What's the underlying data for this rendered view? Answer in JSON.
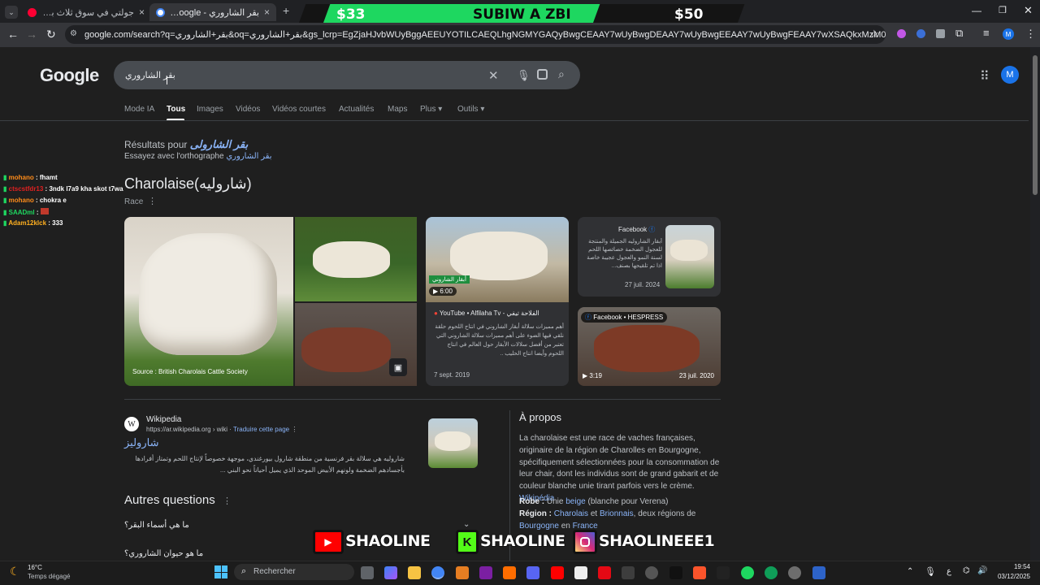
{
  "browser": {
    "tabs": [
      {
        "title": "جولتي في سوق ثلاث براكة الراضي",
        "close": "×"
      },
      {
        "title": "بقر الشاروري - Rechercher Google",
        "close": "×"
      }
    ],
    "new_tab": "+",
    "url": "google.com/search?q=بقر+الشاروري&oq=بقر+الشاروري&gs_lcrp=EgZjaHJvbWUyBggAEEUYOTILCAEQLhgNGMYGAQyBwgCEAAY7wUyBwgDEAAY7wUyBwgEEAAY7wUyBwgFEAAY7wXSAQkxMzM0MWowajeoAgCwAg...",
    "profile_initial": "M"
  },
  "stream_banner": {
    "left": "$33",
    "center": "SUBIW A ZBI",
    "right": "$50"
  },
  "search": {
    "logo": "Google",
    "query": "بقر الشاروري",
    "tabs": [
      "Mode IA",
      "Tous",
      "Images",
      "Vidéos",
      "Vidéos courtes",
      "Actualités",
      "Maps",
      "Plus",
      "Outils"
    ],
    "active_tab": "Tous"
  },
  "spelling": {
    "results_for_label": "Résultats pour",
    "corrected": "بقر الشارولى",
    "try_label": "Essayez avec l'orthographe",
    "original": "بقر الشاروري"
  },
  "knowledge": {
    "title": "Charolaise(شاروليه)",
    "subtitle": "Race",
    "image_credit": "Source : British Charolais Cattle Society"
  },
  "video_card": {
    "badge": "أبقار الشاروني",
    "duration": "6:00",
    "source": "YouTube • Alfilaha Tv - الفلاحة تيفي",
    "text": "أهم مميزات سلالة أبقار الشاروني في انتاج اللحوم حلقة نلقي فيها الضوء على أهم مميزات سلالة الشاروني التي تعتبر من أفضل سلالات الأبقار حول العالم في انتاج اللحوم وأيضا انتاج الحليب ..",
    "date": "7 sept. 2019"
  },
  "facebook_card": {
    "source": "Facebook",
    "text": "أبقار الشاروليه الجميلة والمنتجة للعجول الضخمة خصائصها اللحم لسنة النمو والعجول عجيبة خاصة اذا تم تلقيحها بصنف...",
    "date": "27 juil. 2024"
  },
  "hespress_card": {
    "source": "Facebook • HESPRESS",
    "duration": "3:19",
    "date": "23 juil. 2020"
  },
  "wiki_result": {
    "site": "Wikipedia",
    "url": "https://ar.wikipedia.org › wiki",
    "translate": "Traduire cette page",
    "title": "شاروليز",
    "snippet": "شاروليه هي سلالة بقر فرنسية من منطقة شارول بيورغندي، موجهة خصوصاً لإنتاج اللحم وتمتاز أفرادها بأجسادهم الضخمة ولونهم الأبيض الموحد الذي يميل أحياناً نحو البني ..."
  },
  "paa": {
    "title": "Autres questions",
    "questions": [
      "ما هي أسماء البقر؟",
      "ما هو حيوان الشاروري؟"
    ]
  },
  "about": {
    "title": "À propos",
    "description": "La charolaise est une race de vaches françaises, originaire de la région de Charolles en Bourgogne, spécifiquement sélectionnées pour la consommation de leur chair, dont les individus sont de grand gabarit et de couleur blanche unie tirant parfois vers le crème.",
    "source_link": "Wikipédia",
    "robe_label": "Robe :",
    "robe_text1": "Unie",
    "robe_link": "beige",
    "robe_text2": "(blanche pour Verena)",
    "region_label": "Région :",
    "region_link1": "Charolais",
    "region_and": "et",
    "region_link2": "Brionnais",
    "region_text": ", deux régions de",
    "region_link3": "Bourgogne",
    "region_en": "en",
    "region_link4": "France"
  },
  "chat": [
    {
      "user": "mohano",
      "msg": "fhamt",
      "color": "#ff8c1a"
    },
    {
      "user": "ctscstfdr13",
      "msg": "3ndk l7a9 kha skot t7wa",
      "color": "#e02020"
    },
    {
      "user": "mohano",
      "msg": "chokra e",
      "color": "#ff8c1a"
    },
    {
      "user": "SAADml",
      "msg": "",
      "color": "#1ed760"
    },
    {
      "user": "Adam12klck",
      "msg": "333",
      "color": "#ffb020"
    }
  ],
  "social": {
    "youtube": "SHAOLINE",
    "kick": "SHAOLINE",
    "instagram": "SHAOLINEEE1"
  },
  "taskbar": {
    "weather_temp": "16°C",
    "weather_desc": "Temps dégagé",
    "search_placeholder": "Rechercher",
    "time": "19:54",
    "date": "03/12/2025",
    "lang": "ع"
  }
}
